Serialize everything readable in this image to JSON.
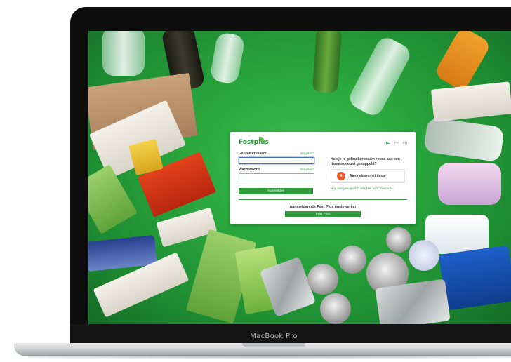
{
  "device": {
    "model_label": "MacBook Pro"
  },
  "app": {
    "logo": "Fostplus",
    "languages": [
      {
        "code": "NL",
        "active": true
      },
      {
        "code": "FR",
        "active": false
      },
      {
        "code": "EN",
        "active": false
      }
    ]
  },
  "login": {
    "username_label": "Gebruikersnaam",
    "username_value": "",
    "forgot_username": "Vergeten?",
    "password_label": "Wachtwoord",
    "password_value": "",
    "forgot_password": "Vergeten?",
    "submit_label": "Aanmelden"
  },
  "itsme": {
    "question": "Heb je je gebruikersnaam reeds aan een itsme-account gekoppeld?",
    "button_label": "Aanmelden met itsme",
    "icon_text": "it",
    "help_link": "Nog niet gekoppeld? Klik hier voor meer info."
  },
  "staff": {
    "title": "Aanmelden als Fost Plus medewerker",
    "button_label": "Fost Plus"
  },
  "colors": {
    "brand_green": "#2f9d3e",
    "itsme_orange": "#e8562a",
    "background_green": "#29a53c"
  }
}
